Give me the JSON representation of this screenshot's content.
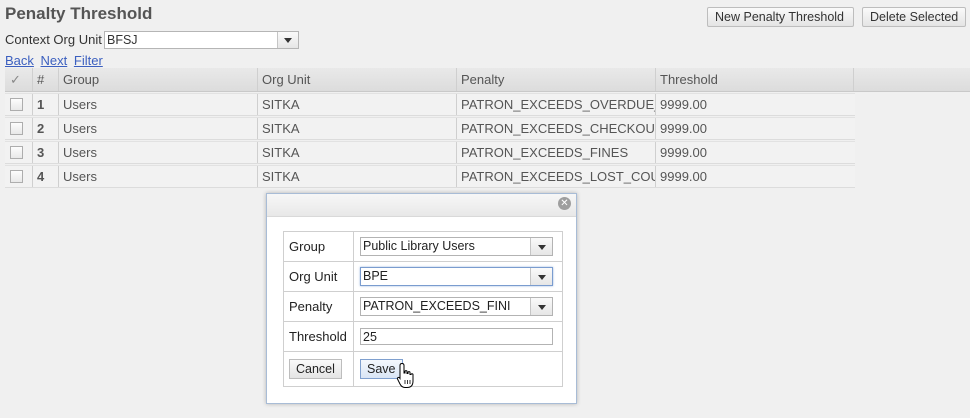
{
  "page": {
    "title": "Penalty Threshold",
    "new_button": "New Penalty Threshold",
    "delete_button": "Delete Selected"
  },
  "context": {
    "label": "Context Org Unit",
    "value": "BFSJ"
  },
  "nav": {
    "back": "Back",
    "next": "Next",
    "filter": "Filter"
  },
  "grid": {
    "headers": {
      "check": "✓",
      "num": "#",
      "group": "Group",
      "org_unit": "Org Unit",
      "penalty": "Penalty",
      "threshold": "Threshold"
    },
    "rows": [
      {
        "num": "1",
        "group": "Users",
        "org_unit": "SITKA",
        "penalty": "PATRON_EXCEEDS_OVERDUE_",
        "threshold": "9999.00"
      },
      {
        "num": "2",
        "group": "Users",
        "org_unit": "SITKA",
        "penalty": "PATRON_EXCEEDS_CHECKOUT",
        "threshold": "9999.00"
      },
      {
        "num": "3",
        "group": "Users",
        "org_unit": "SITKA",
        "penalty": "PATRON_EXCEEDS_FINES",
        "threshold": "9999.00"
      },
      {
        "num": "4",
        "group": "Users",
        "org_unit": "SITKA",
        "penalty": "PATRON_EXCEEDS_LOST_COU",
        "threshold": "9999.00"
      }
    ]
  },
  "dialog": {
    "fields": {
      "group": {
        "label": "Group",
        "value": "Public Library Users"
      },
      "org_unit": {
        "label": "Org Unit",
        "value": "BPE"
      },
      "penalty": {
        "label": "Penalty",
        "value": "PATRON_EXCEEDS_FINI"
      },
      "threshold": {
        "label": "Threshold",
        "value": "25"
      }
    },
    "cancel": "Cancel",
    "save": "Save"
  }
}
